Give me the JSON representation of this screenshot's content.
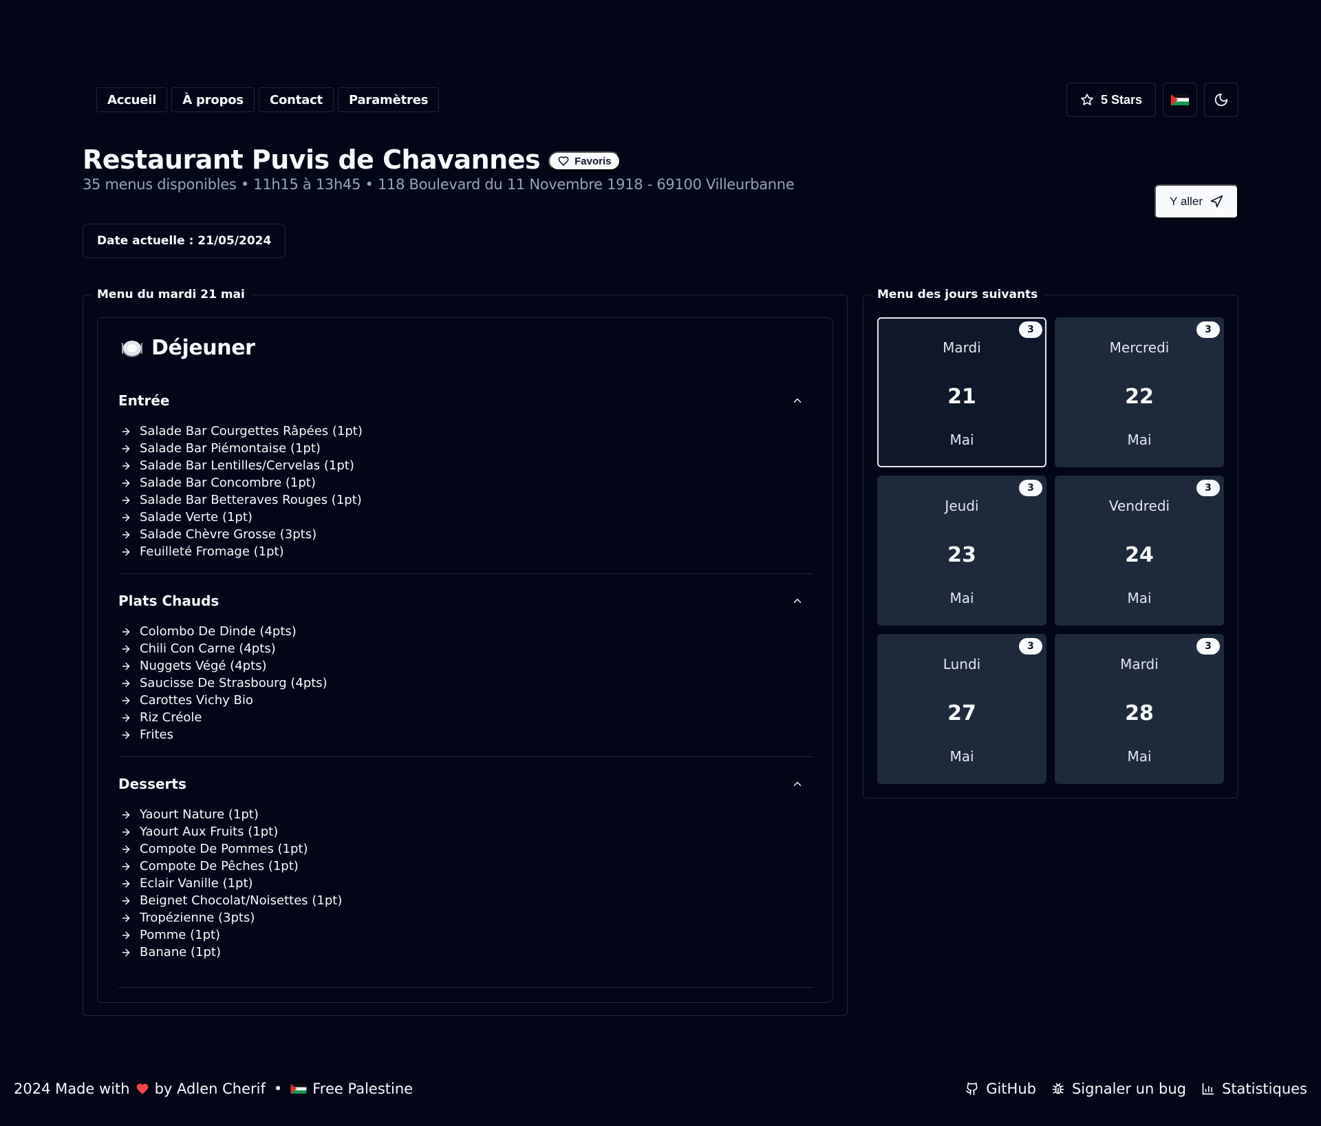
{
  "nav": {
    "items": [
      "Accueil",
      "À propos",
      "Contact",
      "Paramètres"
    ]
  },
  "actions": {
    "stars_label": "5 Stars"
  },
  "header": {
    "title": "Restaurant Puvis de Chavannes",
    "favorite_label": "Favoris",
    "subtitle": "35 menus disponibles • 11h15 à 13h45 • 118 Boulevard du 11 Novembre 1918 - 69100 Villeurbanne",
    "go_label": "Y aller",
    "current_date": "Date actuelle : 21/05/2024"
  },
  "menu": {
    "legend": "Menu du mardi 21 mai",
    "meal_title": "Déjeuner",
    "sections": [
      {
        "title": "Entrée",
        "items": [
          "Salade Bar Courgettes Râpées (1pt)",
          "Salade Bar Piémontaise (1pt)",
          "Salade Bar Lentilles/Cervelas (1pt)",
          "Salade Bar Concombre (1pt)",
          "Salade Bar Betteraves Rouges (1pt)",
          "Salade Verte (1pt)",
          "Salade Chèvre Grosse (3pts)",
          "Feuilleté Fromage (1pt)"
        ]
      },
      {
        "title": "Plats Chauds",
        "items": [
          "Colombo De Dinde (4pts)",
          "Chili Con Carne (4pts)",
          "Nuggets Végé (4pts)",
          "Saucisse De Strasbourg (4pts)",
          "Carottes Vichy Bio",
          "Riz Créole",
          "Frites"
        ]
      },
      {
        "title": "Desserts",
        "items": [
          "Yaourt Nature (1pt)",
          "Yaourt Aux Fruits (1pt)",
          "Compote De Pommes (1pt)",
          "Compote De Pêches (1pt)",
          "Eclair Vanille (1pt)",
          "Beignet Chocolat/Noisettes (1pt)",
          "Tropézienne (3pts)",
          "Pomme (1pt)",
          "Banane (1pt)"
        ]
      }
    ]
  },
  "next_days": {
    "legend": "Menu des jours suivants",
    "days": [
      {
        "day": "Mardi",
        "num": "21",
        "month": "Mai",
        "count": "3",
        "selected": true
      },
      {
        "day": "Mercredi",
        "num": "22",
        "month": "Mai",
        "count": "3",
        "selected": false
      },
      {
        "day": "Jeudi",
        "num": "23",
        "month": "Mai",
        "count": "3",
        "selected": false
      },
      {
        "day": "Vendredi",
        "num": "24",
        "month": "Mai",
        "count": "3",
        "selected": false
      },
      {
        "day": "Lundi",
        "num": "27",
        "month": "Mai",
        "count": "3",
        "selected": false
      },
      {
        "day": "Mardi",
        "num": "28",
        "month": "Mai",
        "count": "3",
        "selected": false
      }
    ]
  },
  "footer": {
    "made_prefix": "2024 Made with",
    "made_suffix": "by Adlen Cherif",
    "separator": "•",
    "palestine": "Free Palestine",
    "github": "GitHub",
    "bug": "Signaler un bug",
    "stats": "Statistiques"
  },
  "colors": {
    "background": "#020617",
    "card": "#1e293b",
    "border": "#1e293b",
    "muted_text": "#94a3b8",
    "heart": "#ef4444"
  }
}
